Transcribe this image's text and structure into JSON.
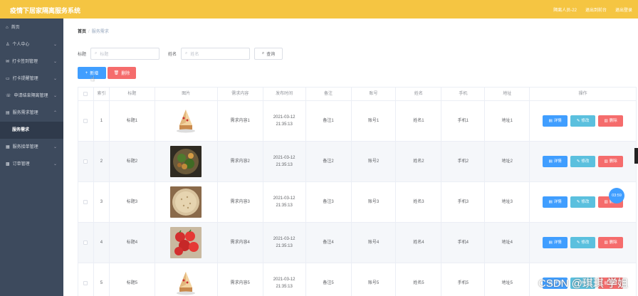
{
  "header": {
    "title": "疫情下居家隔离服务系统",
    "user": "隔离人员-22",
    "back_home": "退出到前台",
    "logout": "退出登录"
  },
  "sidebar": {
    "items": [
      {
        "label": "首页",
        "icon": "home-icon"
      },
      {
        "label": "个人中心",
        "icon": "user-icon"
      },
      {
        "label": "打卡签到管理",
        "icon": "mail-icon"
      },
      {
        "label": "打卡提醒管理",
        "icon": "chat-icon"
      },
      {
        "label": "申请结束隔离管理",
        "icon": "phone-icon"
      },
      {
        "label": "服务需求管理",
        "icon": "list-icon"
      },
      {
        "label": "服务接单管理",
        "icon": "grid-icon"
      },
      {
        "label": "订单管理",
        "icon": "apps-icon"
      }
    ],
    "active_sub": "服务需求"
  },
  "breadcrumb": {
    "home": "首页",
    "sep": "/",
    "current": "服务需求"
  },
  "search": {
    "title_label": "标题",
    "title_placeholder": "标题",
    "name_label": "姓名",
    "name_placeholder": "姓名",
    "query_label": "查询"
  },
  "actions": {
    "add_label": "新增",
    "delete_label": "删除"
  },
  "table": {
    "headers": [
      "索引",
      "标题",
      "图片",
      "需求内容",
      "发布时间",
      "备注",
      "账号",
      "姓名",
      "手机",
      "地址",
      "操作"
    ],
    "rows": [
      {
        "index": "1",
        "title": "标题1",
        "image": "cake",
        "content": "需求内容1",
        "time": "2021-03-12 21:35:13",
        "note": "备注1",
        "account": "账号1",
        "name": "姓名1",
        "phone": "手机1",
        "address": "地址1"
      },
      {
        "index": "2",
        "title": "标题2",
        "image": "salad",
        "content": "需求内容2",
        "time": "2021-03-12 21:35:13",
        "note": "备注2",
        "account": "账号2",
        "name": "姓名2",
        "phone": "手机2",
        "address": "地址2"
      },
      {
        "index": "3",
        "title": "标题3",
        "image": "grain",
        "content": "需求内容3",
        "time": "2021-03-12 21:35:13",
        "note": "备注3",
        "account": "账号3",
        "name": "姓名3",
        "phone": "手机3",
        "address": "地址3"
      },
      {
        "index": "4",
        "title": "标题4",
        "image": "tomato",
        "content": "需求内容4",
        "time": "2021-03-12 21:35:13",
        "note": "备注4",
        "account": "账号4",
        "name": "姓名4",
        "phone": "手机4",
        "address": "地址4"
      },
      {
        "index": "5",
        "title": "标题5",
        "image": "cake",
        "content": "需求内容5",
        "time": "2021-03-12 21:35:13",
        "note": "备注5",
        "account": "账号5",
        "name": "姓名5",
        "phone": "手机5",
        "address": "地址5"
      }
    ],
    "op_detail": "详情",
    "op_edit": "修改",
    "op_delete": "删除"
  },
  "timer": "03:59",
  "watermark": "CSDN @琪琪 学姐",
  "colors": {
    "topbar": "#f5c542",
    "sidebar": "#3d4a5d",
    "primary": "#409eff",
    "danger": "#f56c6c",
    "info": "#5bc0de"
  }
}
